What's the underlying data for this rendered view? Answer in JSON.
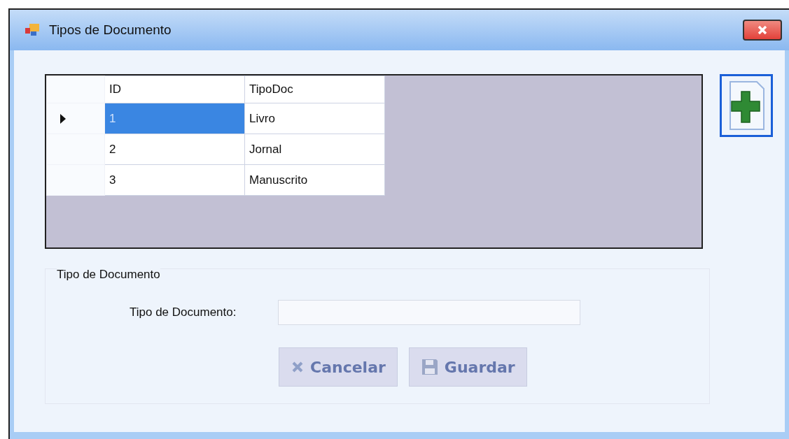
{
  "window": {
    "title": "Tipos de Documento"
  },
  "table": {
    "columns": [
      "ID",
      "TipoDoc"
    ],
    "rows": [
      {
        "cells": [
          "1",
          "Livro"
        ],
        "selected": true
      },
      {
        "cells": [
          "2",
          "Jornal"
        ],
        "selected": false
      },
      {
        "cells": [
          "3",
          "Manuscrito"
        ],
        "selected": false
      }
    ]
  },
  "group": {
    "title": "Tipo de Documento",
    "field_label": "Tipo de Documento:"
  },
  "buttons": [
    {
      "kind": "cancel",
      "label": "Cancelar",
      "disabled": true
    },
    {
      "kind": "save",
      "label": "Guardar",
      "disabled": true
    }
  ]
}
